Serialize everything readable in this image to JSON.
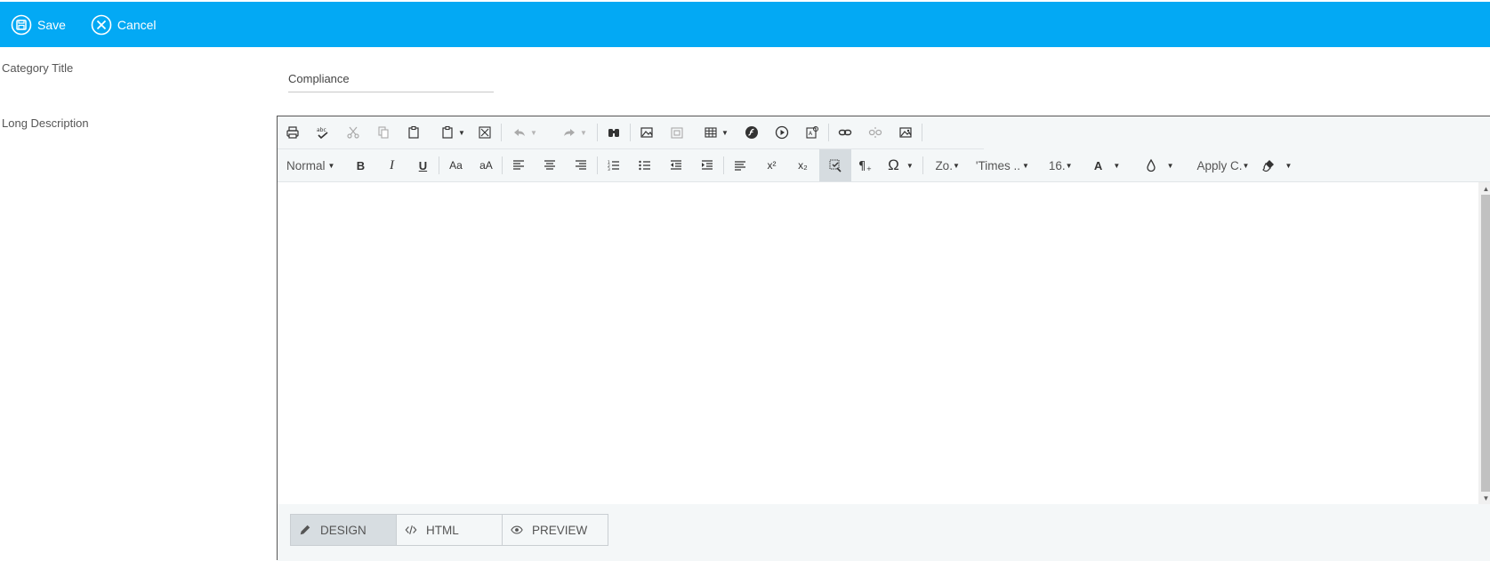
{
  "topbar": {
    "save_label": "Save",
    "cancel_label": "Cancel",
    "background": "#03a9f4"
  },
  "form": {
    "category_title_label": "Category Title",
    "category_title_value": "Compliance",
    "long_description_label": "Long Description"
  },
  "toolbar_row1": [
    {
      "name": "print-icon"
    },
    {
      "name": "spellcheck-icon"
    },
    {
      "name": "cut-icon"
    },
    {
      "name": "copy-icon"
    },
    {
      "name": "paste-icon"
    },
    {
      "name": "paste-options-icon"
    },
    {
      "name": "fullscreen-icon"
    },
    {
      "name": "undo-icon"
    },
    {
      "name": "redo-icon"
    },
    {
      "name": "find-icon"
    },
    {
      "name": "insert-image-icon"
    },
    {
      "name": "image-manager-icon"
    },
    {
      "name": "table-icon"
    },
    {
      "name": "flash-icon"
    },
    {
      "name": "media-icon"
    },
    {
      "name": "document-manager-icon"
    },
    {
      "name": "link-icon"
    },
    {
      "name": "unlink-icon"
    },
    {
      "name": "image-map-icon"
    }
  ],
  "toolbar_row2": {
    "paragraph_style": "Normal",
    "bold": "B",
    "italic": "I",
    "underline": "U",
    "lower_case": "Aa",
    "upper_case": "aA",
    "superscript": "x²",
    "subscript": "x₂",
    "zoom": "Zo.",
    "font_name": "'Times ..",
    "font_size": "16.",
    "fore_color": "A",
    "apply_css": "Apply C."
  },
  "modes": {
    "design": "DESIGN",
    "html": "HTML",
    "preview": "PREVIEW",
    "active": "DESIGN"
  },
  "content": {
    "text": ""
  }
}
